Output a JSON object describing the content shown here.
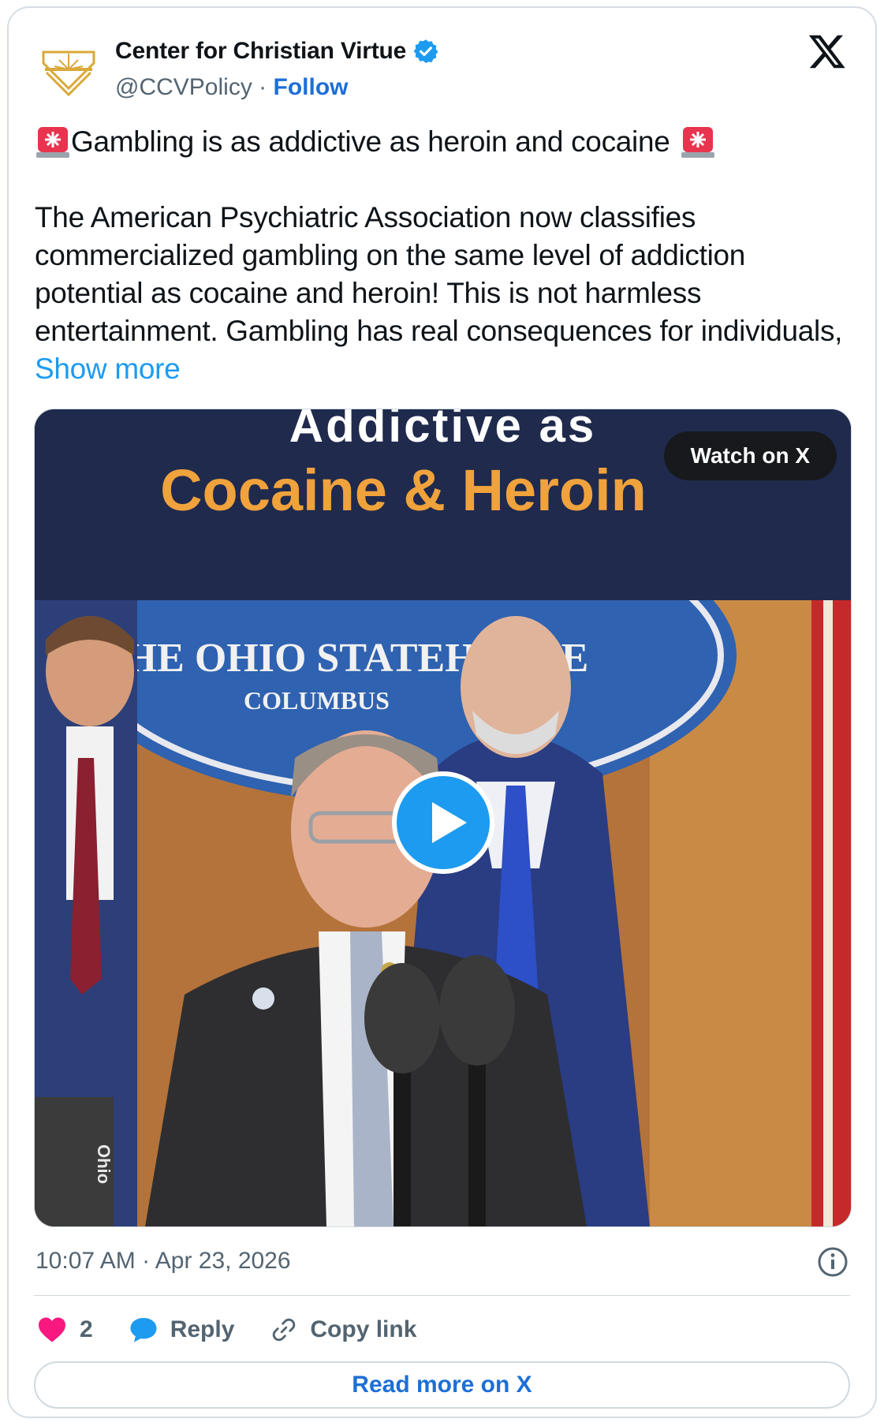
{
  "account": {
    "name": "Center for Christian Virtue",
    "handle": "@CCVPolicy",
    "separator": " · ",
    "follow_label": "Follow"
  },
  "tweet": {
    "headline": "Gambling is as addictive as heroin and cocaine",
    "body": "The American Psychiatric Association now classifies commercialized gambling on the same level of addiction potential as cocaine and heroin! This is not harmless entertainment. Gambling has real consequences for individuals, ",
    "show_more": "Show more"
  },
  "media": {
    "banner_top": "Addictive as",
    "banner_main": "Cocaine & Heroin",
    "watch_label": "Watch on X",
    "seal_line1": "THE OHIO STATEHOUSE",
    "seal_line2": "COLUMBUS",
    "podium_text": "Ohio"
  },
  "meta": {
    "timestamp": "10:07 AM · Apr 23, 2026"
  },
  "actions": {
    "like_count": "2",
    "reply_label": "Reply",
    "copy_label": "Copy link"
  },
  "footer": {
    "read_more_label": "Read more on X"
  },
  "colors": {
    "accent": "#1d9bf0",
    "follow": "#1d6fd6",
    "banner_bg": "#1f2a4d",
    "banner_text": "#f0a23c",
    "like": "#f91880"
  }
}
